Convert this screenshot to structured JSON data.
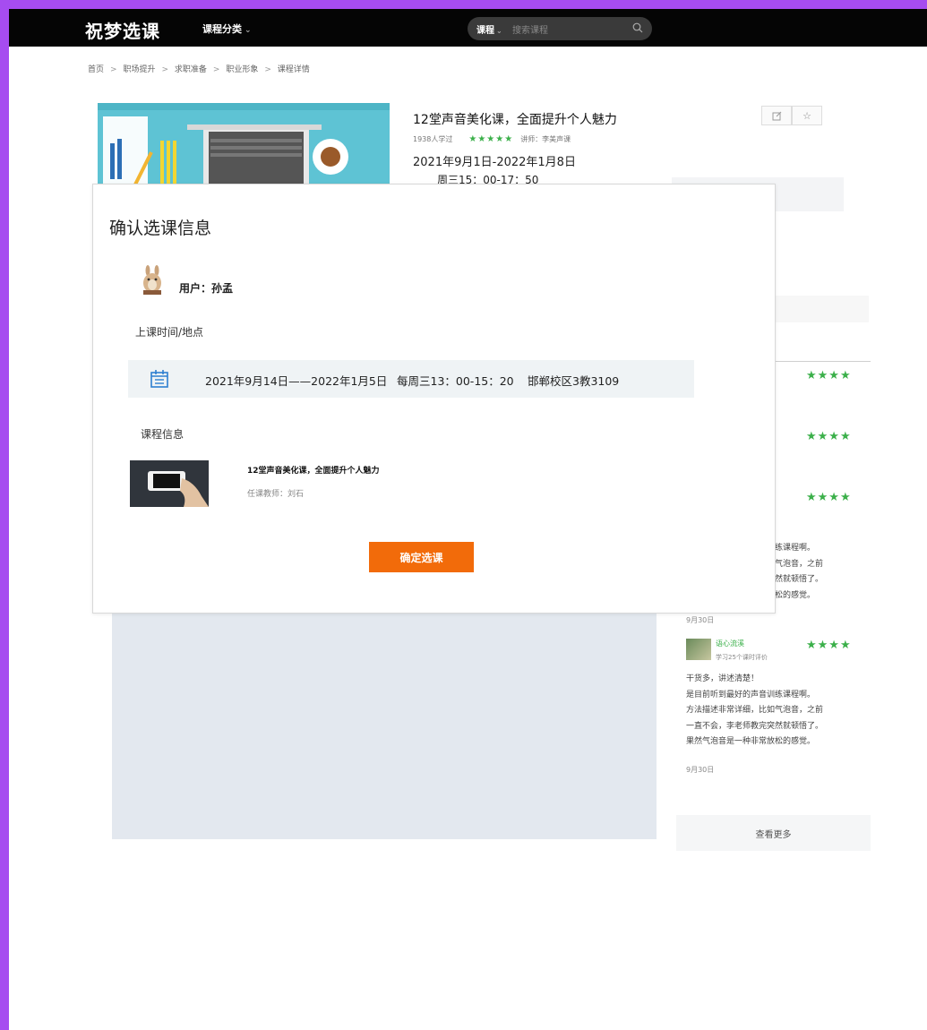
{
  "header": {
    "logo": "祝梦选课",
    "category_label": "课程分类",
    "search_scope": "课程",
    "search_placeholder": "搜索课程"
  },
  "breadcrumb": [
    "首页",
    "职场提升",
    "求职准备",
    "职业形象",
    "课程详情"
  ],
  "course": {
    "title": "12堂声音美化课，全面提升个人魅力",
    "learners": "1938人学过",
    "stars": "★★★★★",
    "teacher_short": "讲师：李美声课",
    "date_range": "2021年9月1日-2022年1月8日",
    "time_partial": "周三15：00-17：50"
  },
  "modal": {
    "title": "确认选课信息",
    "user_label": "用户：孙孟",
    "time_section_label": "上课时间/地点",
    "time_row": {
      "dates": "2021年9月14日——2022年1月5日",
      "weekly": "每周三13：00-15：20",
      "location": "邯郸校区3教3109"
    },
    "info_section_label": "课程信息",
    "info_title": "12堂声音美化课，全面提升个人魅力",
    "info_teacher": "任课教师：刘石",
    "confirm_label": "确定选课"
  },
  "reviews": {
    "stars": "★★★★",
    "partial_text": [
      "训练课程啊。",
      "如气泡音，之前",
      "突然就顿悟了。",
      "放松的感觉。"
    ],
    "partial_date": "9月30日",
    "full_review": {
      "name": "语心流溪",
      "sub": "学习25个课时评价",
      "lines": [
        "干货多，讲述清楚！",
        "是目前听到最好的声音训练课程啊。",
        "方法描述非常详细，比如气泡音，之前",
        "一直不会，李老师教完突然就顿悟了。",
        "果然气泡音是一种非常放松的感觉。"
      ],
      "date": "9月30日"
    },
    "more_label": "查看更多"
  }
}
